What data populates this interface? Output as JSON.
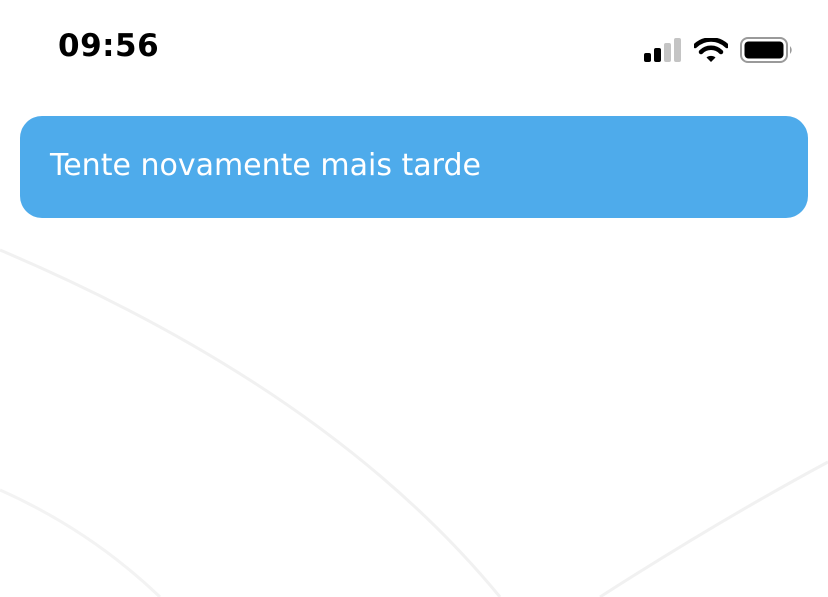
{
  "status_bar": {
    "time": "09:56",
    "signal_icon": "cellular-signal-icon",
    "wifi_icon": "wifi-icon",
    "battery_icon": "battery-icon"
  },
  "toast": {
    "message": "Tente novamente mais tarde",
    "background_color": "#4eabeb",
    "text_color": "#ffffff"
  }
}
